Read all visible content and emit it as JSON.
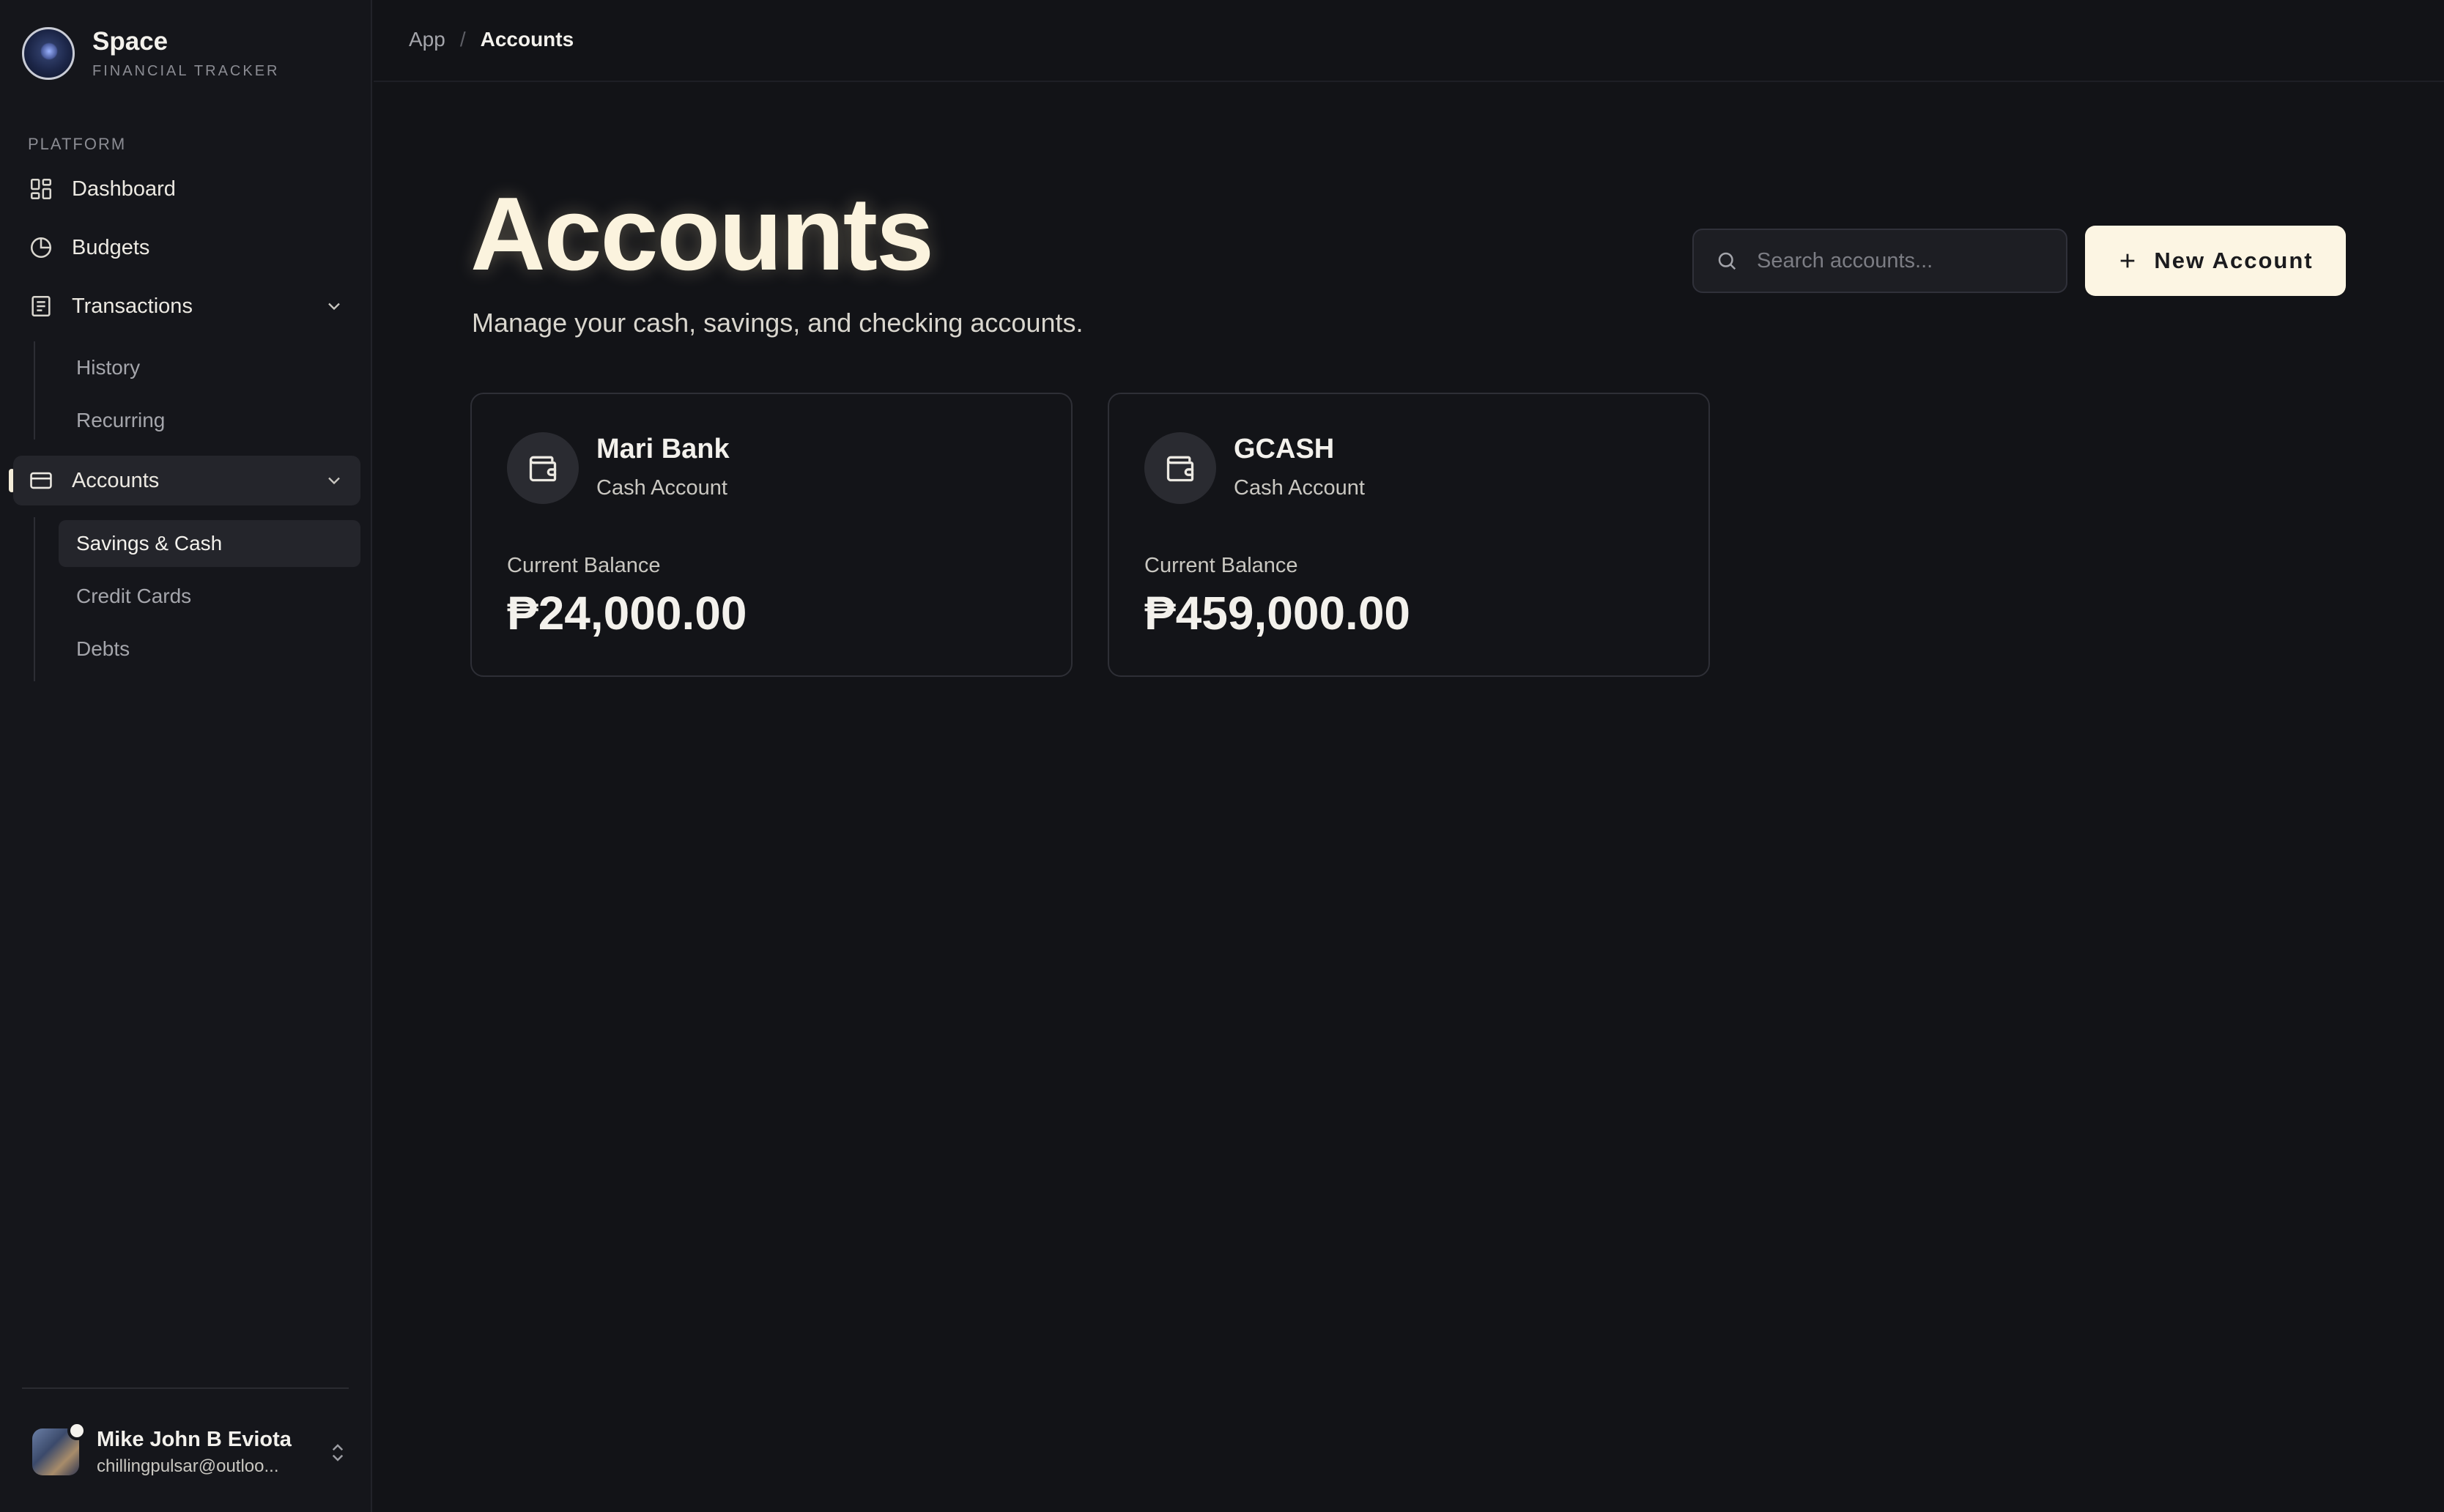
{
  "app": {
    "name": "Space",
    "subtitle": "FINANCIAL TRACKER"
  },
  "sidebar": {
    "section_label": "PLATFORM",
    "items": [
      {
        "label": "Dashboard",
        "icon": "dashboard-grid-icon"
      },
      {
        "label": "Budgets",
        "icon": "pie-chart-icon"
      },
      {
        "label": "Transactions",
        "icon": "receipt-icon",
        "expanded": true,
        "children": [
          {
            "label": "History"
          },
          {
            "label": "Recurring"
          }
        ]
      },
      {
        "label": "Accounts",
        "icon": "credit-card-icon",
        "expanded": true,
        "active": true,
        "children": [
          {
            "label": "Savings & Cash",
            "selected": true
          },
          {
            "label": "Credit Cards"
          },
          {
            "label": "Debts"
          }
        ]
      }
    ]
  },
  "user": {
    "name": "Mike John B Eviota",
    "email": "chillingpulsar@outloo..."
  },
  "breadcrumb": {
    "root": "App",
    "separator": "/",
    "current": "Accounts"
  },
  "page": {
    "title": "Accounts",
    "subtitle": "Manage your cash, savings, and checking accounts."
  },
  "search": {
    "placeholder": "Search accounts...",
    "value": ""
  },
  "new_account_button": {
    "label": "New Account"
  },
  "balance_label": "Current Balance",
  "accounts": [
    {
      "name": "Mari Bank",
      "type": "Cash Account",
      "balance": "₱24,000.00"
    },
    {
      "name": "GCASH",
      "type": "Cash Account",
      "balance": "₱459,000.00"
    }
  ],
  "colors": {
    "background": "#121317",
    "sidebar": "#15161b",
    "accent": "#fcf5e3",
    "title": "#fbf3de"
  }
}
